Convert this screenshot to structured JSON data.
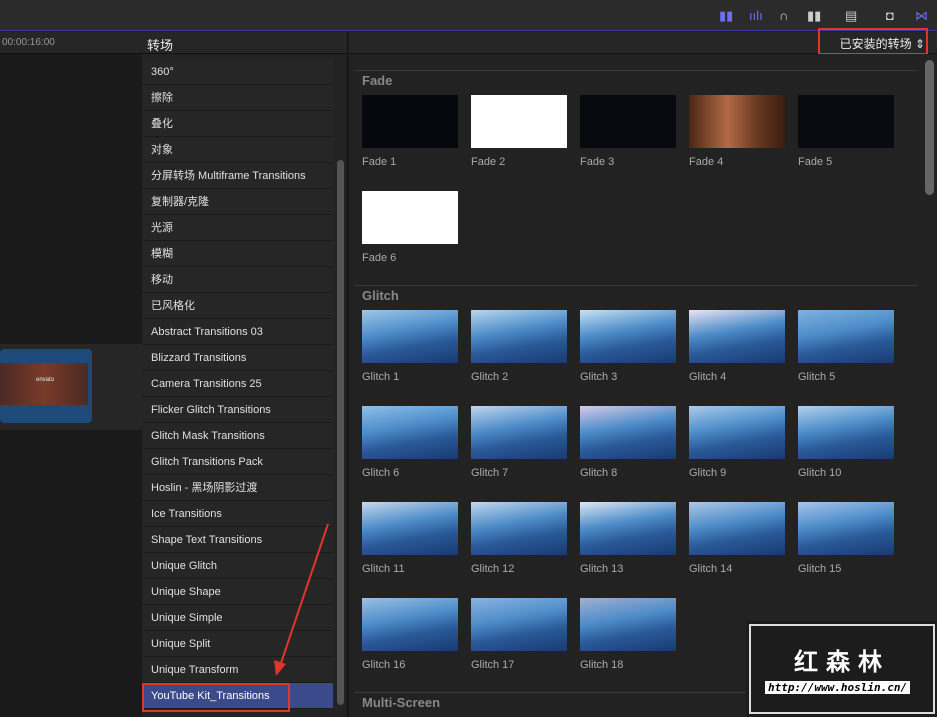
{
  "toolbar": {
    "icons": [
      "clip-appearance-icon",
      "audio-waveform-icon",
      "headphones-icon",
      "skimming-icon",
      "filmstrip-icon",
      "window-icon",
      "transitions-browser-icon"
    ]
  },
  "timeline": {
    "timecode": "00:00:16:00",
    "clip_label": "envato"
  },
  "sidebar": {
    "title": "转场",
    "items": [
      "360°",
      "擦除",
      "叠化",
      "对象",
      "分屏转场 Multiframe Transitions",
      "复制器/克隆",
      "光源",
      "模糊",
      "移动",
      "已风格化",
      "Abstract Transitions 03",
      "Blizzard Transitions",
      "Camera Transitions 25",
      "Flicker Glitch Transitions",
      "Glitch Mask Transitions",
      "Glitch Transitions Pack",
      "Hoslin - 黑场阴影过渡",
      "Ice Transitions",
      "Shape Text Transitions",
      "Unique Glitch",
      "Unique Shape",
      "Unique Simple",
      "Unique Split",
      "Unique Transform",
      "YouTube Kit_Transitions"
    ],
    "selected": "YouTube Kit_Transitions"
  },
  "browser": {
    "filter": "已安装的转场",
    "sections": [
      {
        "title": "Fade",
        "items": [
          "Fade 1",
          "Fade 2",
          "Fade 3",
          "Fade 4",
          "Fade 5",
          "Fade 6"
        ]
      },
      {
        "title": "Glitch",
        "items": [
          "Glitch 1",
          "Glitch 2",
          "Glitch 3",
          "Glitch 4",
          "Glitch 5",
          "Glitch 6",
          "Glitch 7",
          "Glitch 8",
          "Glitch 9",
          "Glitch 10",
          "Glitch 11",
          "Glitch 12",
          "Glitch 13",
          "Glitch 14",
          "Glitch 15",
          "Glitch 16",
          "Glitch 17",
          "Glitch 18"
        ]
      },
      {
        "title": "Multi-Screen",
        "items": []
      }
    ]
  },
  "watermark": {
    "title": "红森林",
    "url": "http://www.hoslin.cn/"
  },
  "colors": {
    "accent": "#3b4a8a",
    "annotation": "#e0352b"
  }
}
